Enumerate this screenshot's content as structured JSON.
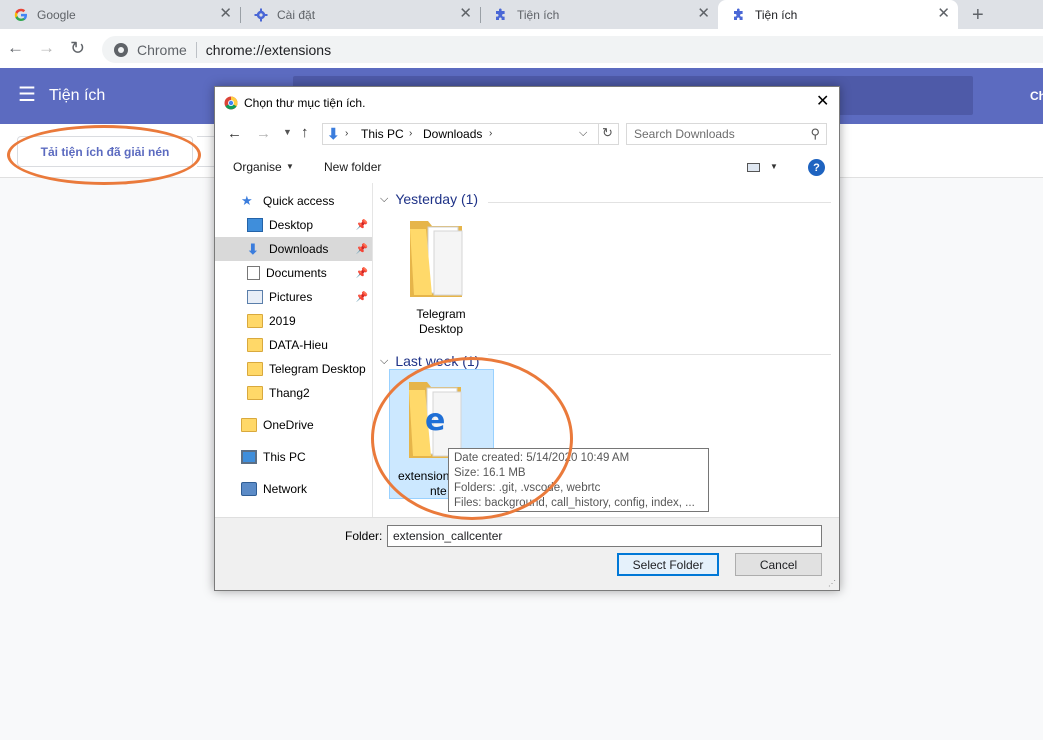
{
  "browser": {
    "tabs": [
      {
        "title": "Google",
        "icon": "google-icon",
        "active": false
      },
      {
        "title": "Cài đặt",
        "icon": "gear-icon",
        "active": false
      },
      {
        "title": "Tiện ích",
        "icon": "puzzle-icon",
        "active": false
      },
      {
        "title": "Tiện ích",
        "icon": "puzzle-icon",
        "active": true
      }
    ],
    "new_tab": "+",
    "omnibox": {
      "site_label": "Chrome",
      "url": "chrome://extensions"
    }
  },
  "extensions_page": {
    "header_title": "Tiện ích",
    "header_right_fragment": "Ch",
    "load_unpacked_label": "Tải tiện ích đã giải nén",
    "accent": "#5c6bc0"
  },
  "dialog": {
    "title": "Chọn thư mục tiện ích.",
    "breadcrumb": [
      "This PC",
      "Downloads"
    ],
    "search_placeholder": "Search Downloads",
    "organise_label": "Organise",
    "new_folder_label": "New folder",
    "nav": {
      "quick_access": "Quick access",
      "pinned": [
        {
          "label": "Desktop",
          "icon": "desktop-icon"
        },
        {
          "label": "Downloads",
          "icon": "download-arrow-icon",
          "selected": true
        },
        {
          "label": "Documents",
          "icon": "document-icon"
        },
        {
          "label": "Pictures",
          "icon": "pictures-icon"
        }
      ],
      "folders": [
        "2019",
        "DATA-Hieu",
        "Telegram Desktop",
        "Thang2"
      ],
      "onedrive": "OneDrive",
      "this_pc": "This PC",
      "network": "Network"
    },
    "groups": [
      {
        "header": "Yesterday (1)",
        "items": [
          "Telegram\nDesktop"
        ]
      },
      {
        "header": "Last week (1)",
        "items": [
          "extension_callcenter"
        ]
      }
    ],
    "selected_item_partial": [
      "extension",
      "nte"
    ],
    "tooltip": [
      "Date created: 5/14/2020 10:49 AM",
      "Size: 16.1 MB",
      "Folders: .git, .vscode, webrtc",
      "Files: background, call_history, config, index, ..."
    ],
    "folder_label": "Folder:",
    "folder_value": "extension_callcenter",
    "select_button": "Select Folder",
    "cancel_button": "Cancel"
  },
  "annotation_color": "#ea7a3b"
}
